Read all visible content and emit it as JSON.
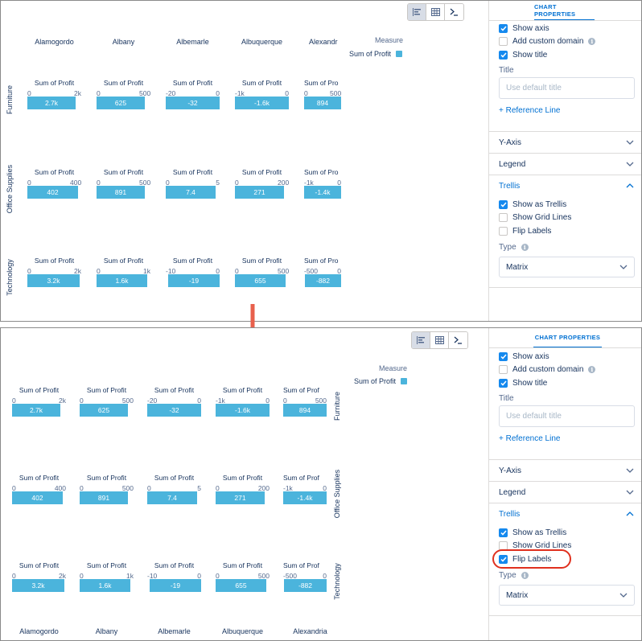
{
  "toolbar": {
    "icons": [
      "bar-chart-icon",
      "table-icon",
      "console-icon"
    ]
  },
  "trellis": {
    "cities": [
      "Alamogordo",
      "Albany",
      "Albemarle",
      "Albuquerque",
      "Alexandria"
    ],
    "top_col_headers": [
      "Alamogordo",
      "Albany",
      "Albemarle",
      "Albuquerque",
      "Alexandr"
    ],
    "categories": [
      "Furniture",
      "Office Supplies",
      "Technology"
    ],
    "cell_title": "Sum of Profit",
    "last_cell_title": "Sum of Prof",
    "last_cell_title_top": "Sum of Pro",
    "measure_label": "Measure",
    "legend_item": "Sum of Profit",
    "accent_color": "#4bb4dc"
  },
  "chart_data": {
    "type": "bar",
    "layout": "trellis-matrix",
    "title": "",
    "measure": "Sum of Profit",
    "columns": [
      "Alamogordo",
      "Albany",
      "Albemarle",
      "Albuquerque",
      "Alexandria"
    ],
    "rows": [
      "Furniture",
      "Office Supplies",
      "Technology"
    ],
    "cells": [
      [
        {
          "value_label": "2.7k",
          "value": 2700,
          "axis": [
            "0",
            "2k"
          ],
          "xlim": [
            0,
            3000
          ]
        },
        {
          "value_label": "625",
          "value": 625,
          "axis": [
            "0",
            "500"
          ],
          "xlim": [
            0,
            700
          ]
        },
        {
          "value_label": "-32",
          "value": -32,
          "axis": [
            "-20",
            "0"
          ],
          "xlim": [
            -32,
            0
          ]
        },
        {
          "value_label": "-1.6k",
          "value": -1600,
          "axis": [
            "-1k",
            "0"
          ],
          "xlim": [
            -1600,
            0
          ]
        },
        {
          "value_label": "894",
          "value": 894,
          "axis": [
            "0",
            "500"
          ],
          "xlim": [
            0,
            894
          ]
        }
      ],
      [
        {
          "value_label": "402",
          "value": 402,
          "axis": [
            "0",
            "400"
          ],
          "xlim": [
            0,
            430
          ]
        },
        {
          "value_label": "891",
          "value": 891,
          "axis": [
            "0",
            "500"
          ],
          "xlim": [
            0,
            1000
          ]
        },
        {
          "value_label": "7.4",
          "value": 7.4,
          "axis": [
            "0",
            "5"
          ],
          "xlim": [
            0,
            8
          ]
        },
        {
          "value_label": "271",
          "value": 271,
          "axis": [
            "0",
            "200"
          ],
          "xlim": [
            0,
            300
          ]
        },
        {
          "value_label": "-1.4k",
          "value": -1400,
          "axis": [
            "-1k",
            "0"
          ],
          "xlim": [
            -1400,
            0
          ]
        }
      ],
      [
        {
          "value_label": "3.2k",
          "value": 3200,
          "axis": [
            "0",
            "2k"
          ],
          "xlim": [
            0,
            3300
          ]
        },
        {
          "value_label": "1.6k",
          "value": 1600,
          "axis": [
            "0",
            "1k"
          ],
          "xlim": [
            0,
            1700
          ]
        },
        {
          "value_label": "-19",
          "value": -19,
          "axis": [
            "-10",
            "0"
          ],
          "xlim": [
            -20,
            0
          ]
        },
        {
          "value_label": "655",
          "value": 655,
          "axis": [
            "0",
            "500"
          ],
          "xlim": [
            0,
            700
          ]
        },
        {
          "value_label": "-882",
          "value": -882,
          "axis": [
            "-500",
            "0"
          ],
          "xlim": [
            -900,
            0
          ]
        }
      ]
    ]
  },
  "sidebar": {
    "tab": "CHART PROPERTIES",
    "show_axis": "Show axis",
    "add_custom_domain": "Add custom domain",
    "show_title": "Show title",
    "title_label": "Title",
    "title_placeholder": "Use default title",
    "reference_line": "+ Reference Line",
    "y_axis": "Y-Axis",
    "legend": "Legend",
    "trellis": "Trellis",
    "show_as_trellis": "Show as Trellis",
    "show_grid_lines": "Show Grid Lines",
    "flip_labels": "Flip Labels",
    "type_label": "Type",
    "type_value": "Matrix"
  },
  "states": {
    "top": {
      "show_axis": true,
      "add_custom_domain": false,
      "show_title": true,
      "show_as_trellis": true,
      "show_grid_lines": false,
      "flip_labels": false
    },
    "bottom": {
      "show_axis": true,
      "add_custom_domain": false,
      "show_title": true,
      "show_as_trellis": true,
      "show_grid_lines": false,
      "flip_labels": true
    }
  },
  "colors": {
    "bar": "#4bb4dc",
    "link": "#0070d2",
    "checkbox": "#1589ee",
    "highlight": "#e0301e",
    "arrow": "#e8604c"
  }
}
